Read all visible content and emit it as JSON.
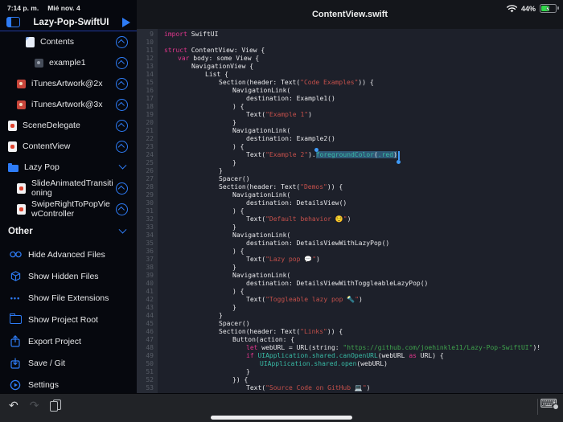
{
  "colors": {
    "accent": "#2e7cf6",
    "keyword": "#e0368c",
    "string": "#c5504b",
    "url_string": "#3fa34d",
    "method": "#38bba6",
    "selection_bg": "#2e5674",
    "selection_handle": "#3f9bf8",
    "battery_green": "#32d74b"
  },
  "status_bar": {
    "time": "7:14 p. m.",
    "date": "Mié nov. 4",
    "battery_percent": "44%"
  },
  "titlebar": {
    "title": "ContentView.swift"
  },
  "sidebar": {
    "project_name": "Lazy-Pop-SwiftUI",
    "files": [
      {
        "label": "Contents",
        "icon": "doc-blue",
        "indent": 2,
        "accessory": "open"
      },
      {
        "label": "example1",
        "icon": "image-dark",
        "indent": 3,
        "accessory": "open"
      },
      {
        "label": "iTunesArtwork@2x",
        "icon": "image-red",
        "indent": 1,
        "accessory": "open"
      },
      {
        "label": "iTunesArtwork@3x",
        "icon": "image-red",
        "indent": 1,
        "accessory": "open"
      },
      {
        "label": "SceneDelegate",
        "icon": "swift-file",
        "indent": 0,
        "accessory": "open"
      },
      {
        "label": "ContentView",
        "icon": "swift-file",
        "indent": 0,
        "accessory": "open"
      },
      {
        "label": "Lazy Pop",
        "icon": "folder",
        "indent": 0,
        "accessory": "chevron"
      },
      {
        "label": "SlideAnimatedTransitioning",
        "icon": "swift-file",
        "indent": 1,
        "accessory": "open"
      },
      {
        "label": "SwipeRightToPopViewController",
        "icon": "swift-file",
        "indent": 1,
        "accessory": "open"
      }
    ],
    "other_header": "Other",
    "options": [
      {
        "label": "Hide Advanced Files",
        "icon": "glasses"
      },
      {
        "label": "Show Hidden Files",
        "icon": "cube"
      },
      {
        "label": "Show File Extensions",
        "icon": "dots"
      },
      {
        "label": "Show Project Root",
        "icon": "folder-outline"
      },
      {
        "label": "Export Project",
        "icon": "share-up"
      },
      {
        "label": "Save / Git",
        "icon": "save-down"
      },
      {
        "label": "Settings",
        "icon": "settings"
      }
    ]
  },
  "editor": {
    "lines": [
      {
        "n": 9,
        "ind": 0,
        "segs": [
          [
            "k",
            "import"
          ],
          [
            "p",
            " SwiftUI"
          ]
        ]
      },
      {
        "n": 10,
        "ind": 0,
        "segs": []
      },
      {
        "n": 11,
        "ind": 0,
        "segs": [
          [
            "k",
            "struct"
          ],
          [
            "p",
            " ContentView: View {"
          ]
        ]
      },
      {
        "n": 12,
        "ind": 1,
        "segs": [
          [
            "k",
            "var"
          ],
          [
            "p",
            " body: some View {"
          ]
        ]
      },
      {
        "n": 13,
        "ind": 2,
        "segs": [
          [
            "p",
            "NavigationView {"
          ]
        ]
      },
      {
        "n": 14,
        "ind": 3,
        "segs": [
          [
            "p",
            "List {"
          ]
        ]
      },
      {
        "n": 15,
        "ind": 4,
        "segs": [
          [
            "p",
            "Section(header: Text("
          ],
          [
            "s",
            "\"Code Examples\""
          ],
          [
            "p",
            ")) {"
          ]
        ]
      },
      {
        "n": 16,
        "ind": 5,
        "segs": [
          [
            "p",
            "NavigationLink("
          ]
        ]
      },
      {
        "n": 17,
        "ind": 6,
        "segs": [
          [
            "p",
            "destination: Example1()"
          ]
        ]
      },
      {
        "n": 18,
        "ind": 5,
        "segs": [
          [
            "p",
            ") {"
          ]
        ]
      },
      {
        "n": 19,
        "ind": 6,
        "segs": [
          [
            "p",
            "Text("
          ],
          [
            "s",
            "\"Example 1\""
          ],
          [
            "p",
            ")"
          ]
        ]
      },
      {
        "n": 20,
        "ind": 5,
        "segs": [
          [
            "p",
            "}"
          ]
        ]
      },
      {
        "n": 21,
        "ind": 5,
        "segs": [
          [
            "p",
            "NavigationLink("
          ]
        ]
      },
      {
        "n": 22,
        "ind": 6,
        "segs": [
          [
            "p",
            "destination: Example2()"
          ]
        ]
      },
      {
        "n": 23,
        "ind": 5,
        "segs": [
          [
            "p",
            ") {"
          ]
        ]
      },
      {
        "n": 24,
        "ind": 6,
        "segs": [
          [
            "p",
            "Text("
          ],
          [
            "s",
            "\"Example 2\""
          ],
          [
            "p",
            ")."
          ],
          [
            "HS",
            ""
          ],
          [
            "tS",
            "foregroundColor"
          ],
          [
            "pS",
            "("
          ],
          [
            "tS",
            ".red"
          ],
          [
            "pS",
            ")"
          ],
          [
            "CE",
            ""
          ]
        ]
      },
      {
        "n": 25,
        "ind": 5,
        "segs": [
          [
            "p",
            "}"
          ]
        ]
      },
      {
        "n": 26,
        "ind": 4,
        "segs": [
          [
            "p",
            "}"
          ]
        ]
      },
      {
        "n": 27,
        "ind": 4,
        "segs": [
          [
            "p",
            "Spacer()"
          ]
        ]
      },
      {
        "n": 28,
        "ind": 4,
        "segs": [
          [
            "p",
            "Section(header: Text("
          ],
          [
            "s",
            "\"Demos\""
          ],
          [
            "p",
            ")) {"
          ]
        ]
      },
      {
        "n": 29,
        "ind": 5,
        "segs": [
          [
            "p",
            "NavigationLink("
          ]
        ]
      },
      {
        "n": 30,
        "ind": 6,
        "segs": [
          [
            "p",
            "destination: DetailsView()"
          ]
        ]
      },
      {
        "n": 31,
        "ind": 5,
        "segs": [
          [
            "p",
            ") {"
          ]
        ]
      },
      {
        "n": 32,
        "ind": 6,
        "segs": [
          [
            "p",
            "Text("
          ],
          [
            "s",
            "\"Default behavior 😌\""
          ],
          [
            "p",
            ")"
          ]
        ]
      },
      {
        "n": 33,
        "ind": 5,
        "segs": [
          [
            "p",
            "}"
          ]
        ]
      },
      {
        "n": 34,
        "ind": 5,
        "segs": [
          [
            "p",
            "NavigationLink("
          ]
        ]
      },
      {
        "n": 35,
        "ind": 6,
        "segs": [
          [
            "p",
            "destination: DetailsViewWithLazyPop()"
          ]
        ]
      },
      {
        "n": 36,
        "ind": 5,
        "segs": [
          [
            "p",
            ") {"
          ]
        ]
      },
      {
        "n": 37,
        "ind": 6,
        "segs": [
          [
            "p",
            "Text("
          ],
          [
            "s",
            "\"Lazy pop 💬\""
          ],
          [
            "p",
            ")"
          ]
        ]
      },
      {
        "n": 38,
        "ind": 5,
        "segs": [
          [
            "p",
            "}"
          ]
        ]
      },
      {
        "n": 39,
        "ind": 5,
        "segs": [
          [
            "p",
            "NavigationLink("
          ]
        ]
      },
      {
        "n": 40,
        "ind": 6,
        "segs": [
          [
            "p",
            "destination: DetailsViewWithToggleableLazyPop()"
          ]
        ]
      },
      {
        "n": 41,
        "ind": 5,
        "segs": [
          [
            "p",
            ") {"
          ]
        ]
      },
      {
        "n": 42,
        "ind": 6,
        "segs": [
          [
            "p",
            "Text("
          ],
          [
            "s",
            "\"Toggleable lazy pop 🔦\""
          ],
          [
            "p",
            ")"
          ]
        ]
      },
      {
        "n": 43,
        "ind": 5,
        "segs": [
          [
            "p",
            "}"
          ]
        ]
      },
      {
        "n": 44,
        "ind": 4,
        "segs": [
          [
            "p",
            "}"
          ]
        ]
      },
      {
        "n": 45,
        "ind": 4,
        "segs": [
          [
            "p",
            "Spacer()"
          ]
        ]
      },
      {
        "n": 46,
        "ind": 4,
        "segs": [
          [
            "p",
            "Section(header: Text("
          ],
          [
            "s",
            "\"Links\""
          ],
          [
            "p",
            ")) {"
          ]
        ]
      },
      {
        "n": 47,
        "ind": 5,
        "segs": [
          [
            "p",
            "Button(action: {"
          ]
        ]
      },
      {
        "n": 48,
        "ind": 6,
        "segs": [
          [
            "k",
            "let"
          ],
          [
            "p",
            " webURL = URL(string: "
          ],
          [
            "g",
            "\"https://github.com/joehinkle11/Lazy-Pop-SwiftUI\""
          ],
          [
            "p",
            ")!"
          ]
        ]
      },
      {
        "n": 49,
        "ind": 6,
        "segs": [
          [
            "k",
            "if"
          ],
          [
            "p",
            " "
          ],
          [
            "t",
            "UIApplication.shared.canOpenURL"
          ],
          [
            "p",
            "(webURL "
          ],
          [
            "k",
            "as"
          ],
          [
            "p",
            " URL) {"
          ]
        ]
      },
      {
        "n": 50,
        "ind": 7,
        "segs": [
          [
            "t",
            "UIApplication.shared.open"
          ],
          [
            "p",
            "(webURL)"
          ]
        ]
      },
      {
        "n": 51,
        "ind": 6,
        "segs": [
          [
            "p",
            "}"
          ]
        ]
      },
      {
        "n": 52,
        "ind": 5,
        "segs": [
          [
            "p",
            "}) {"
          ]
        ]
      },
      {
        "n": 53,
        "ind": 6,
        "segs": [
          [
            "p",
            "Text("
          ],
          [
            "s",
            "\"Source Code on GitHub 💻\""
          ],
          [
            "p",
            ")"
          ]
        ]
      }
    ]
  },
  "bottom_bar": {
    "undo": "↶",
    "redo": "↷"
  }
}
